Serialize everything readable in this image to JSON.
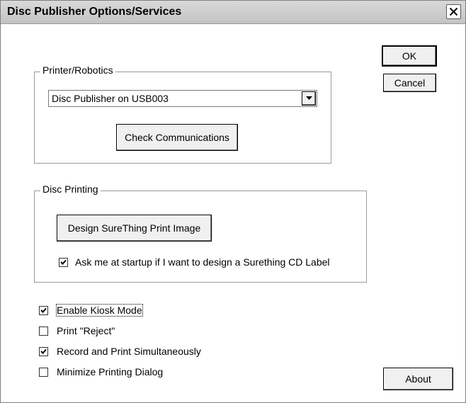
{
  "window": {
    "title": "Disc Publisher Options/Services"
  },
  "buttons": {
    "ok": "OK",
    "cancel": "Cancel",
    "about": "About"
  },
  "printer_group": {
    "label": "Printer/Robotics",
    "printer_select": {
      "value": "Disc Publisher on USB003"
    },
    "check_button": "Check Communications"
  },
  "disc_group": {
    "label": "Disc Printing",
    "design_button": "Design SureThing Print Image",
    "ask_checkbox": {
      "label": "Ask me at startup if I want to design a Surething CD Label",
      "checked": true
    }
  },
  "options": [
    {
      "label": "Enable Kiosk Mode",
      "checked": true
    },
    {
      "label": "Print \"Reject\"",
      "checked": false
    },
    {
      "label": "Record and Print Simultaneously",
      "checked": true
    },
    {
      "label": "Minimize Printing Dialog",
      "checked": false
    }
  ],
  "icons": {
    "close": "close-icon",
    "dropdown": "chevron-down-icon",
    "check": "checkmark-icon"
  }
}
